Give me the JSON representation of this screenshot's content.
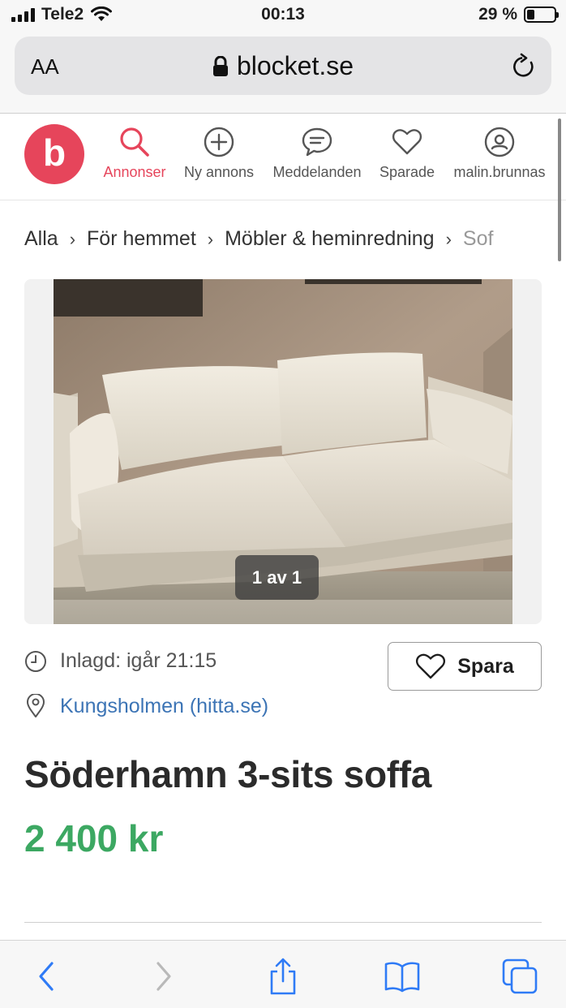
{
  "status_bar": {
    "carrier": "Tele2",
    "time": "00:13",
    "battery": "29 %",
    "battery_level": 0.29
  },
  "browser": {
    "text_size_label": "AA",
    "url": "blocket.se"
  },
  "nav": {
    "items": [
      {
        "label": "Annonser",
        "icon": "search-icon",
        "active": true
      },
      {
        "label": "Ny annons",
        "icon": "plus-circle-icon"
      },
      {
        "label": "Meddelanden",
        "icon": "chat-bubble-icon"
      },
      {
        "label": "Sparade",
        "icon": "heart-icon"
      },
      {
        "label": "malin.brunnas",
        "icon": "user-icon"
      }
    ],
    "accent_color": "#e6455b"
  },
  "breadcrumb": [
    "Alla",
    "För hemmet",
    "Möbler & heminredning",
    "Sof"
  ],
  "listing": {
    "image_counter": "1 av 1",
    "posted": "Inlagd: igår 21:15",
    "location": "Kungsholmen (hitta.se)",
    "save_label": "Spara",
    "title": "Söderhamn 3-sits soffa",
    "price": "2 400 kr",
    "price_color": "#3ca862",
    "link_color": "#3c74b5"
  },
  "toolbar": {
    "icons": [
      "back-icon",
      "forward-icon",
      "share-icon",
      "bookmarks-icon",
      "tabs-icon"
    ],
    "accent_color": "#2f7bf6"
  }
}
